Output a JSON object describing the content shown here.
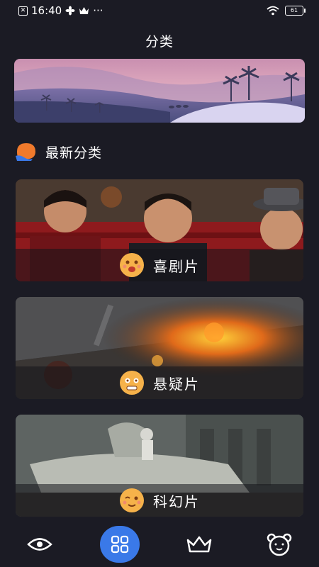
{
  "status_bar": {
    "time": "16:40",
    "dots": "···",
    "battery": "61"
  },
  "page": {
    "title": "分类"
  },
  "section": {
    "title": "最新分类"
  },
  "categories": [
    {
      "label": "喜剧片",
      "mood": "happy"
    },
    {
      "label": "悬疑片",
      "mood": "worried"
    },
    {
      "label": "科幻片",
      "mood": "shy"
    }
  ],
  "nav": {
    "items": [
      {
        "icon": "eye-icon",
        "active": false
      },
      {
        "icon": "grid-icon",
        "active": true
      },
      {
        "icon": "crown-icon",
        "active": false
      },
      {
        "icon": "bear-face-icon",
        "active": false
      }
    ],
    "active_color": "#3a79e8"
  },
  "colors": {
    "background": "#1b1b24",
    "face": "#f6b24a",
    "section_icon": "#f07a2c"
  }
}
